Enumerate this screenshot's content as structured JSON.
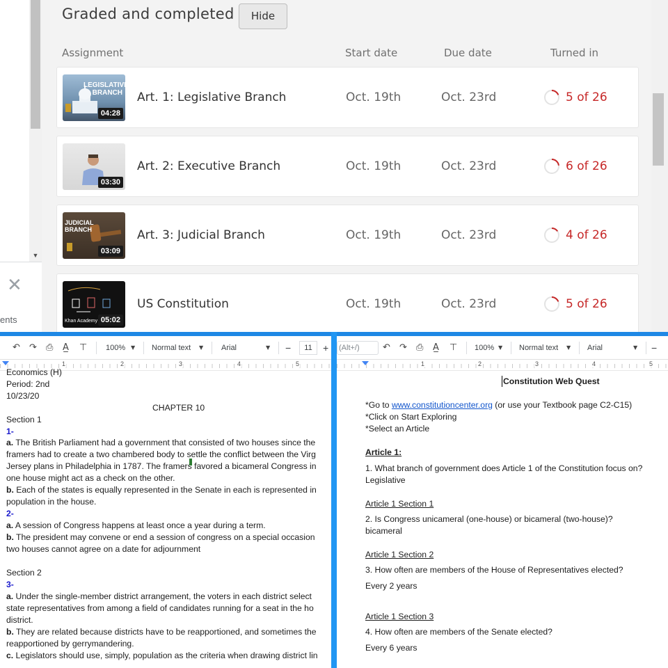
{
  "assignments_app": {
    "section_title": "Graded and completed",
    "hide_label": "Hide",
    "columns": {
      "assignment": "Assignment",
      "start": "Start date",
      "due": "Due date",
      "turned_in": "Turned in"
    },
    "rows": [
      {
        "title": "Art. 1: Legislative Branch",
        "start": "Oct. 19th",
        "due": "Oct. 23rd",
        "turned": "5 of 26",
        "duration": "04:28",
        "thumb_text": "LEGISLATIVE BRANCH",
        "fraction": 0.192
      },
      {
        "title": "Art. 2: Executive Branch",
        "start": "Oct. 19th",
        "due": "Oct. 23rd",
        "turned": "6 of 26",
        "duration": "03:30",
        "thumb_text": "",
        "fraction": 0.231
      },
      {
        "title": "Art. 3: Judicial Branch",
        "start": "Oct. 19th",
        "due": "Oct. 23rd",
        "turned": "4 of 26",
        "duration": "03:09",
        "thumb_text": "JUDICIAL BRANCH",
        "fraction": 0.154
      },
      {
        "title": "US Constitution",
        "start": "Oct. 19th",
        "due": "Oct. 23rd",
        "turned": "5 of 26",
        "duration": "05:02",
        "thumb_text": "Khan Academy",
        "fraction": 0.192
      }
    ],
    "left_cut_label": "ents",
    "status_color": "#c62828"
  },
  "doc_left": {
    "toolbar": {
      "zoom": "100%",
      "style": "Normal text",
      "font": "Arial",
      "size": "11",
      "minus": "−",
      "plus": "+"
    },
    "ruler": [
      "1",
      "2",
      "3",
      "4",
      "5"
    ],
    "lines": {
      "l1": "Economics (H)",
      "l2": "Period: 2nd",
      "l3": "10/23/20",
      "chapter": "CHAPTER 10",
      "sec1": "Section 1",
      "n1": "1-",
      "a1_label": "a.",
      "a1_text": " The British Parliament had a government that consisted of two houses since the",
      "a1_l2": "framers had to create a two chambered body to settle the conflict between the Virg",
      "a1_l3": "Jersey plans in Philadelphia in 1787. The framers favored a bicameral Congress in",
      "a1_l4": "one house might act as a check on the other.",
      "b1_label": "b.",
      "b1_text": " Each of the states is equally represented in the Senate in each is represented in",
      "b1_l2": "population in the house.",
      "n2": "2-",
      "a2_label": "a.",
      "a2_text": " A session of Congress happens at least once a year during a term.",
      "b2_label": "b.",
      "b2_text": " The president may convene or end a session of congress on a special occasion",
      "b2_l2": "two houses cannot agree on a date for adjournment",
      "sec2": "Section 2",
      "n3": "3-",
      "a3_label": "a.",
      "a3_text": " Under the single-member district arrangement, the voters in each district select",
      "a3_l2": "state representatives from among a field of candidates running for a seat in the ho",
      "a3_l3": "district.",
      "b3_label": "b.",
      "b3_text": " They are related because districts have to be reapportioned, and sometimes the",
      "b3_l2": "reapportioned by gerrymandering.",
      "c3_label": "c.",
      "c3_text": " Legislators should use, simply, population as the criteria when drawing district lin"
    }
  },
  "doc_right": {
    "toolbar": {
      "shortcut": "(Alt+/)",
      "zoom": "100%",
      "style": "Normal text",
      "font": "Arial",
      "minus": "−"
    },
    "ruler": [
      "1",
      "2",
      "3",
      "4",
      "5"
    ],
    "lines": {
      "title": "Constitution Web Quest",
      "go_prefix": "*Go to ",
      "go_link": "www.constitutioncenter.org",
      "go_suffix": "  (or use your Textbook page C2-C15)",
      "click": "*Click on Start Exploring",
      "select": "*Select an Article",
      "art1": "Article 1:",
      "q1": "1. What branch of government does Article 1 of the Constitution focus on?",
      "a1": "Legislative",
      "s1": "Article 1 Section 1",
      "q2": "2. Is Congress unicameral (one-house) or bicameral (two-house)?",
      "a2": "bicameral",
      "s2": "Article 1 Section 2",
      "q3": "3. How often are members of the House of Representatives elected?",
      "a3": "Every 2 years",
      "s3": "Article 1 Section 3",
      "q4": "4. How often are members of the Senate elected?",
      "a4": "Every 6 years"
    }
  }
}
